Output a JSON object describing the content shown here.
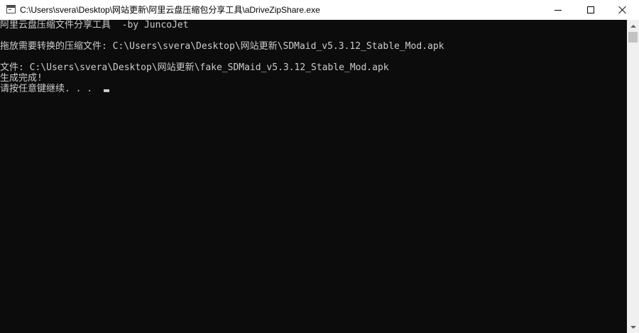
{
  "window": {
    "title": "C:\\Users\\svera\\Desktop\\网站更新\\阿里云盘压缩包分享工具\\aDriveZipShare.exe",
    "icon": "console-app-icon",
    "controls": {
      "minimize": "minimize-icon",
      "maximize": "maximize-icon",
      "close": "close-icon"
    }
  },
  "console": {
    "lines": [
      "阿里云盘压缩文件分享工具  -by JuncoJet",
      "拖放需要转换的压缩文件: C:\\Users\\svera\\Desktop\\网站更新\\SDMaid_v5.3.12_Stable_Mod.apk",
      "文件: C:\\Users\\svera\\Desktop\\网站更新\\fake_SDMaid_v5.3.12_Stable_Mod.apk",
      "生成完成!",
      "请按任意键继续. . ."
    ],
    "text_color": "#cccccc",
    "background": "#0c0c0c"
  },
  "scrollbar": {
    "up": "chevron-up-icon",
    "down": "chevron-down-icon"
  }
}
